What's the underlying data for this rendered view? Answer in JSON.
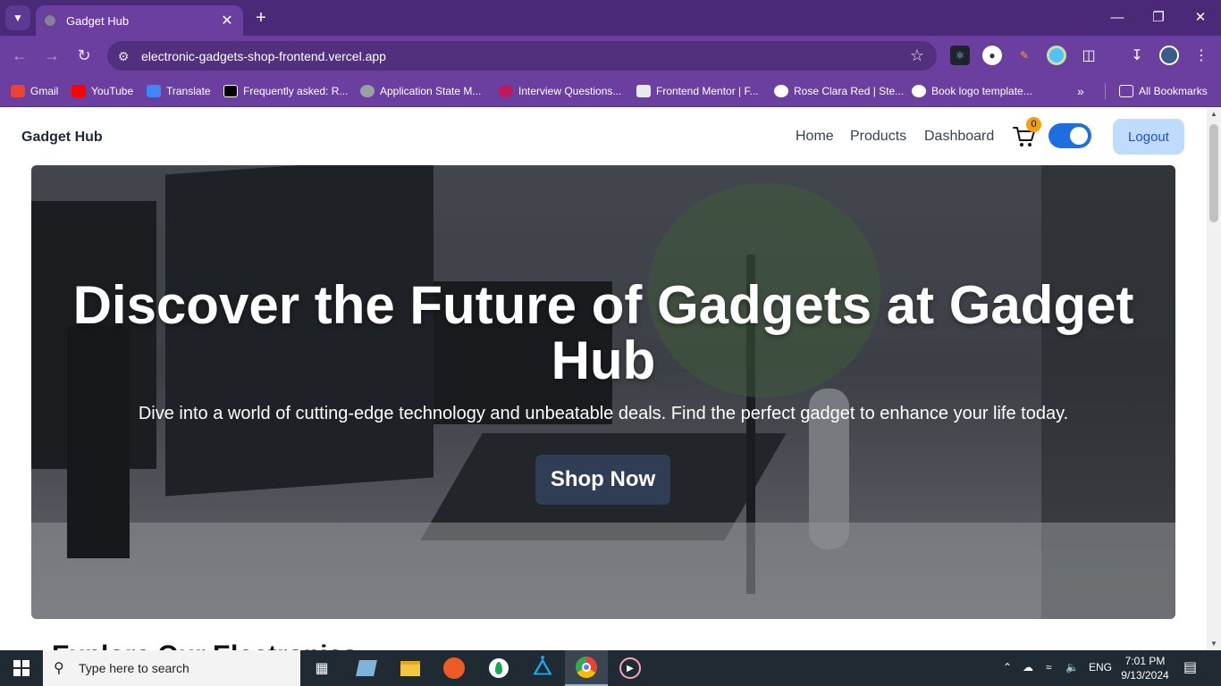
{
  "browser": {
    "tab_title": "Gadget Hub",
    "url": "electronic-gadgets-shop-frontend.vercel.app",
    "bookmarks": [
      {
        "label": "Gmail",
        "color": "#ea4335"
      },
      {
        "label": "YouTube",
        "color": "#ff0000"
      },
      {
        "label": "Translate",
        "color": "#4285f4"
      },
      {
        "label": "Frequently asked: R...",
        "color": "#000000"
      },
      {
        "label": "Application State M...",
        "color": "#9aa0a6"
      },
      {
        "label": "Interview Questions...",
        "color": "#c2185b"
      },
      {
        "label": "Frontend Mentor | F...",
        "color": "#e8eaed"
      },
      {
        "label": "Rose Clara Red | Ste...",
        "color": "#ffffff"
      },
      {
        "label": "Book logo template...",
        "color": "#ffffff"
      }
    ],
    "all_bookmarks": "All Bookmarks",
    "colors": {
      "frame": "#4a2a78",
      "toolbar": "#6a3fa0"
    }
  },
  "site": {
    "brand": "Gadget Hub",
    "nav": {
      "home": "Home",
      "products": "Products",
      "dashboard": "Dashboard"
    },
    "cart_count": "0",
    "theme_toggle_on": true,
    "logout": "Logout",
    "hero": {
      "title_line1": "Discover the Future of Gadgets at Gadget",
      "title_line2": "Hub",
      "subtitle": "Dive into a world of cutting-edge technology and unbeatable deals. Find the perfect gadget to enhance your life today.",
      "cta": "Shop Now"
    },
    "next_section_heading": "Explore Our Electronics"
  },
  "taskbar": {
    "search_placeholder": "Type here to search",
    "language": "ENG",
    "time": "7:01 PM",
    "date": "9/13/2024"
  }
}
